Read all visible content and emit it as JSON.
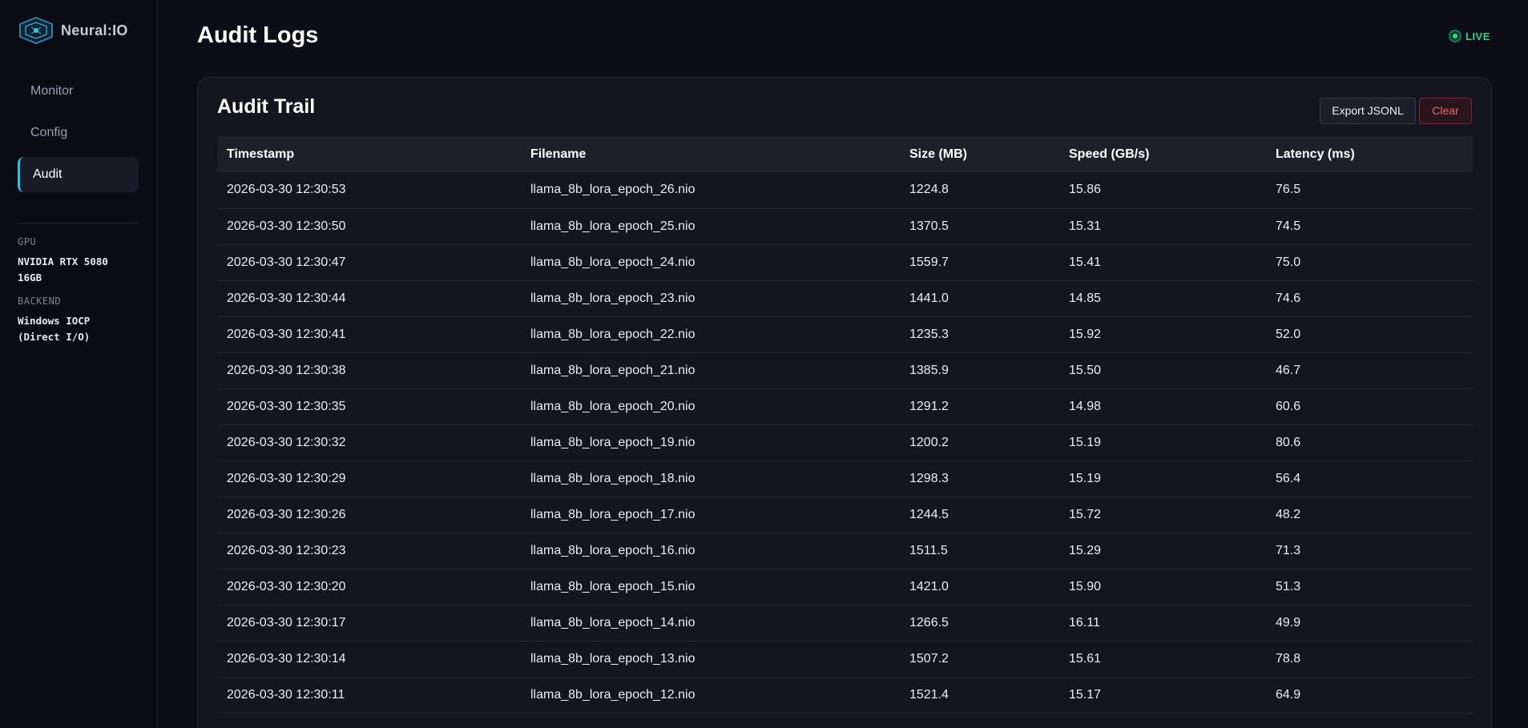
{
  "brand": {
    "name": "Neural:IO"
  },
  "sidebar": {
    "items": [
      {
        "label": "Monitor",
        "active": false
      },
      {
        "label": "Config",
        "active": false
      },
      {
        "label": "Audit",
        "active": true
      }
    ],
    "gpu_label": "GPU",
    "gpu_value": "NVIDIA RTX 5080 16GB",
    "backend_label": "BACKEND",
    "backend_value": "Windows IOCP (Direct I/O)"
  },
  "header": {
    "title": "Audit Logs",
    "status": "LIVE",
    "status_color": "#22d98a"
  },
  "card": {
    "title": "Audit Trail",
    "export_label": "Export JSONL",
    "clear_label": "Clear"
  },
  "table": {
    "columns": [
      "Timestamp",
      "Filename",
      "Size (MB)",
      "Speed (GB/s)",
      "Latency (ms)"
    ],
    "rows": [
      [
        "2026-03-30 12:30:53",
        "llama_8b_lora_epoch_26.nio",
        "1224.8",
        "15.86",
        "76.5"
      ],
      [
        "2026-03-30 12:30:50",
        "llama_8b_lora_epoch_25.nio",
        "1370.5",
        "15.31",
        "74.5"
      ],
      [
        "2026-03-30 12:30:47",
        "llama_8b_lora_epoch_24.nio",
        "1559.7",
        "15.41",
        "75.0"
      ],
      [
        "2026-03-30 12:30:44",
        "llama_8b_lora_epoch_23.nio",
        "1441.0",
        "14.85",
        "74.6"
      ],
      [
        "2026-03-30 12:30:41",
        "llama_8b_lora_epoch_22.nio",
        "1235.3",
        "15.92",
        "52.0"
      ],
      [
        "2026-03-30 12:30:38",
        "llama_8b_lora_epoch_21.nio",
        "1385.9",
        "15.50",
        "46.7"
      ],
      [
        "2026-03-30 12:30:35",
        "llama_8b_lora_epoch_20.nio",
        "1291.2",
        "14.98",
        "60.6"
      ],
      [
        "2026-03-30 12:30:32",
        "llama_8b_lora_epoch_19.nio",
        "1200.2",
        "15.19",
        "80.6"
      ],
      [
        "2026-03-30 12:30:29",
        "llama_8b_lora_epoch_18.nio",
        "1298.3",
        "15.19",
        "56.4"
      ],
      [
        "2026-03-30 12:30:26",
        "llama_8b_lora_epoch_17.nio",
        "1244.5",
        "15.72",
        "48.2"
      ],
      [
        "2026-03-30 12:30:23",
        "llama_8b_lora_epoch_16.nio",
        "1511.5",
        "15.29",
        "71.3"
      ],
      [
        "2026-03-30 12:30:20",
        "llama_8b_lora_epoch_15.nio",
        "1421.0",
        "15.90",
        "51.3"
      ],
      [
        "2026-03-30 12:30:17",
        "llama_8b_lora_epoch_14.nio",
        "1266.5",
        "16.11",
        "49.9"
      ],
      [
        "2026-03-30 12:30:14",
        "llama_8b_lora_epoch_13.nio",
        "1507.2",
        "15.61",
        "78.8"
      ],
      [
        "2026-03-30 12:30:11",
        "llama_8b_lora_epoch_12.nio",
        "1521.4",
        "15.17",
        "64.9"
      ]
    ]
  }
}
